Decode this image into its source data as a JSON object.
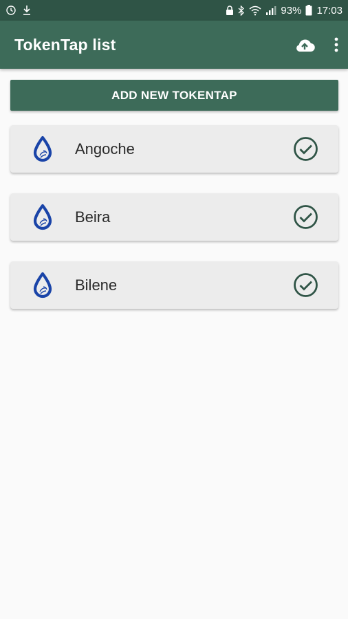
{
  "status_bar": {
    "battery_percent": "93%",
    "time": "17:03",
    "icons": [
      "alarm-icon",
      "download-icon",
      "lock-icon",
      "bluetooth-icon",
      "wifi-icon",
      "signal-icon",
      "battery-icon"
    ]
  },
  "app_bar": {
    "title": "TokenTap list",
    "actions": [
      "cloud-upload-icon",
      "more-vert-icon"
    ]
  },
  "add_button": {
    "label": "ADD NEW TOKENTAP"
  },
  "tokentaps": [
    {
      "name": "Angoche",
      "icon": "water-drop-icon",
      "status_icon": "check-circle-icon"
    },
    {
      "name": "Beira",
      "icon": "water-drop-icon",
      "status_icon": "check-circle-icon"
    },
    {
      "name": "Bilene",
      "icon": "water-drop-icon",
      "status_icon": "check-circle-icon"
    }
  ],
  "colors": {
    "primary": "#3d6b59",
    "status_bar": "#2f5446",
    "drop_icon": "#1a44a8",
    "check_icon": "#2f5446"
  }
}
